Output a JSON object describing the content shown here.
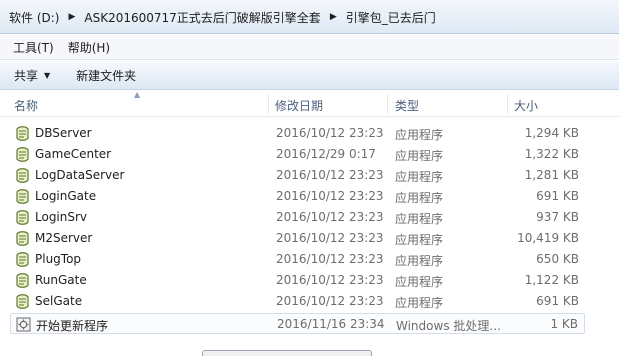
{
  "breadcrumb": {
    "items": [
      "软件 (D:)",
      "ASK201600717正式去后门破解版引擎全套",
      "引擎包_已去后门"
    ],
    "separator": "▶"
  },
  "menu": {
    "items": [
      "工具(T)",
      "帮助(H)"
    ]
  },
  "toolbar": {
    "share_label": "共享",
    "new_folder_label": "新建文件夹"
  },
  "columns": {
    "name": "名称",
    "date": "修改日期",
    "type": "类型",
    "size": "大小"
  },
  "files": [
    {
      "name": "DBServer",
      "date": "2016/10/12 23:23",
      "type": "应用程序",
      "size": "1,294 KB",
      "icon": "exe-shell-icon"
    },
    {
      "name": "GameCenter",
      "date": "2016/12/29 0:17",
      "type": "应用程序",
      "size": "1,322 KB",
      "icon": "exe-shell-icon"
    },
    {
      "name": "LogDataServer",
      "date": "2016/10/12 23:23",
      "type": "应用程序",
      "size": "1,281 KB",
      "icon": "exe-shell-icon"
    },
    {
      "name": "LoginGate",
      "date": "2016/10/12 23:23",
      "type": "应用程序",
      "size": "691 KB",
      "icon": "exe-shell-icon"
    },
    {
      "name": "LoginSrv",
      "date": "2016/10/12 23:23",
      "type": "应用程序",
      "size": "937 KB",
      "icon": "exe-shell-icon"
    },
    {
      "name": "M2Server",
      "date": "2016/10/12 23:23",
      "type": "应用程序",
      "size": "10,419 KB",
      "icon": "exe-shell-icon"
    },
    {
      "name": "PlugTop",
      "date": "2016/10/12 23:23",
      "type": "应用程序",
      "size": "650 KB",
      "icon": "exe-shell-icon"
    },
    {
      "name": "RunGate",
      "date": "2016/10/12 23:23",
      "type": "应用程序",
      "size": "1,122 KB",
      "icon": "exe-shell-icon"
    },
    {
      "name": "SelGate",
      "date": "2016/10/12 23:23",
      "type": "应用程序",
      "size": "691 KB",
      "icon": "exe-shell-icon"
    },
    {
      "name": "开始更新程序",
      "date": "2016/11/16 23:34",
      "type": "Windows 批处理...",
      "size": "1 KB",
      "icon": "batch-file-icon"
    }
  ]
}
